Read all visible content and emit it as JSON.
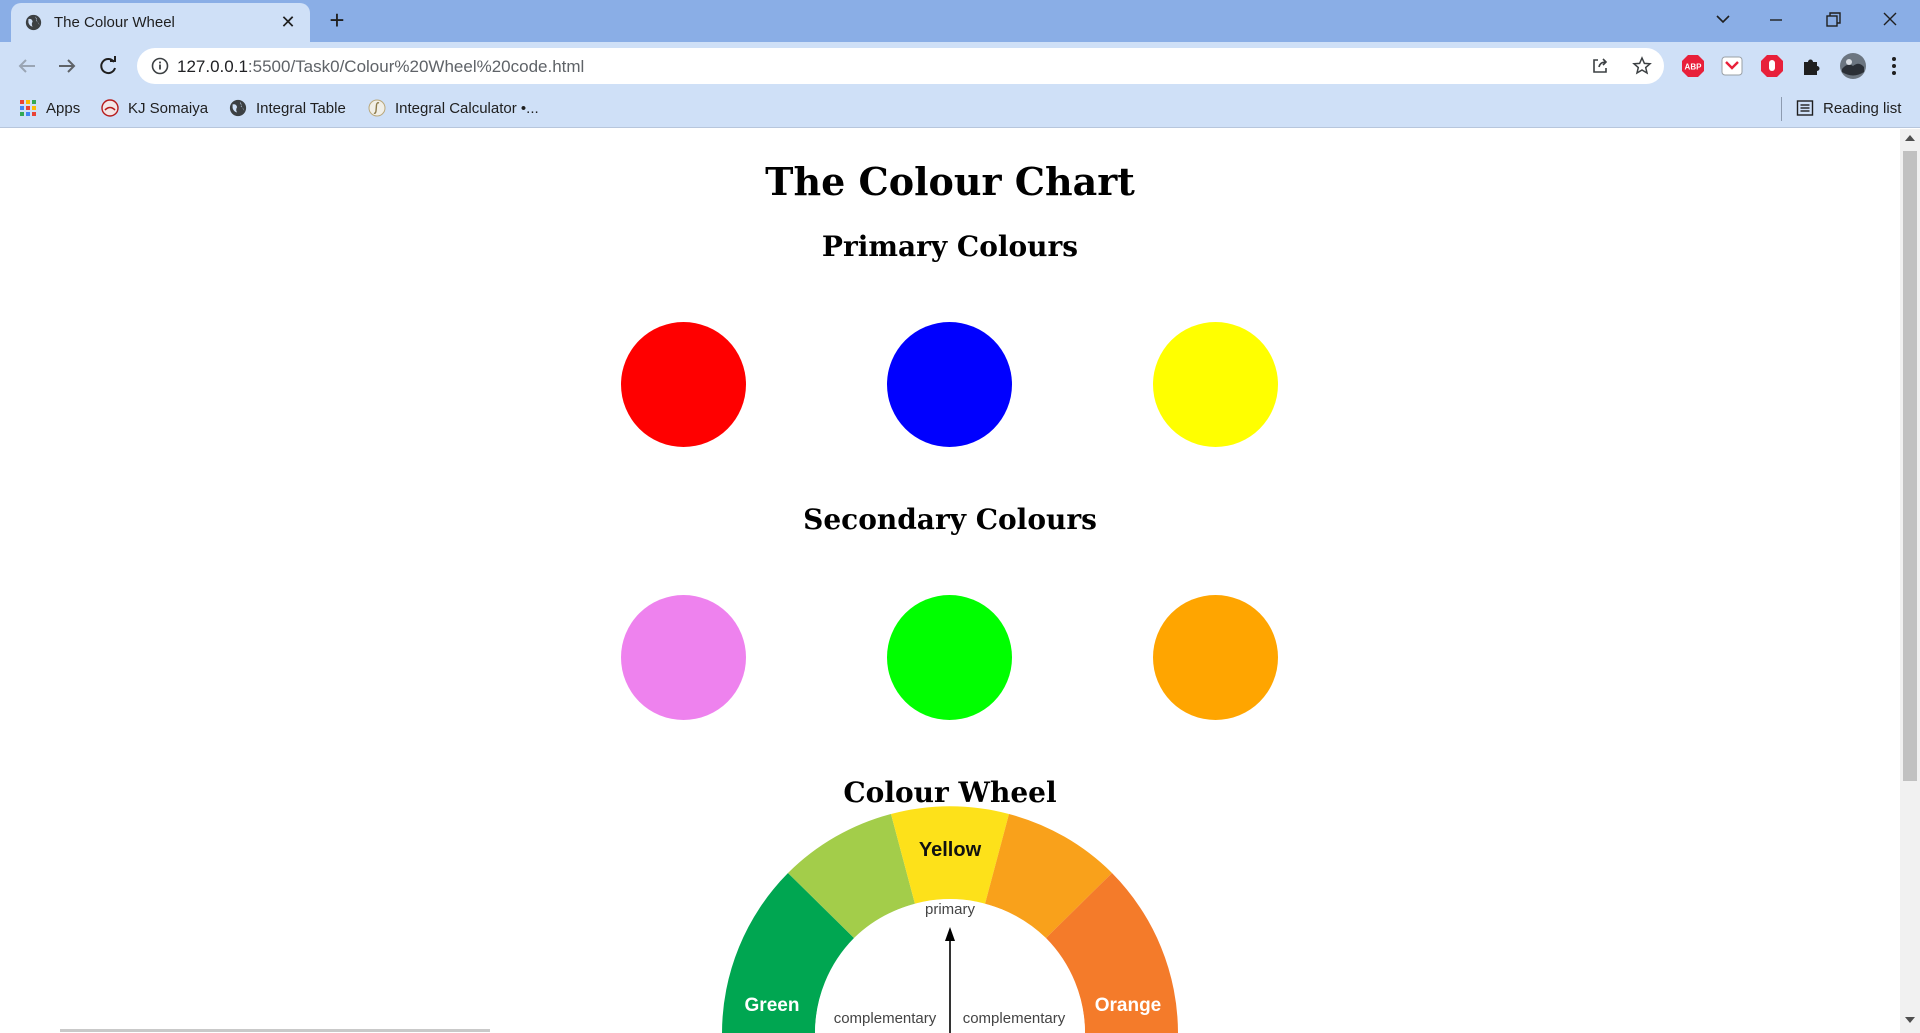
{
  "browser": {
    "tab_title": "The Colour Wheel",
    "url_host": "127.0.0.1",
    "url_path": ":5500/Task0/Colour%20Wheel%20code.html",
    "bookmarks": [
      "Apps",
      "KJ Somaiya",
      "Integral Table",
      "Integral Calculator •..."
    ],
    "reading_list": "Reading list"
  },
  "page": {
    "title": "The Colour Chart",
    "primary_heading": "Primary Colours",
    "secondary_heading": "Secondary Colours",
    "wheel_heading": "Colour Wheel",
    "primary_colours": [
      "#ff0000",
      "#0000ff",
      "#ffff00"
    ],
    "secondary_colours": [
      "#ee82ee",
      "#00ff00",
      "#ffa500"
    ]
  },
  "wheel": {
    "yellow": "Yellow",
    "green": "Green",
    "orange": "Orange",
    "primary": "primary",
    "complementary_left": "complementary",
    "complementary_right": "complementary"
  }
}
